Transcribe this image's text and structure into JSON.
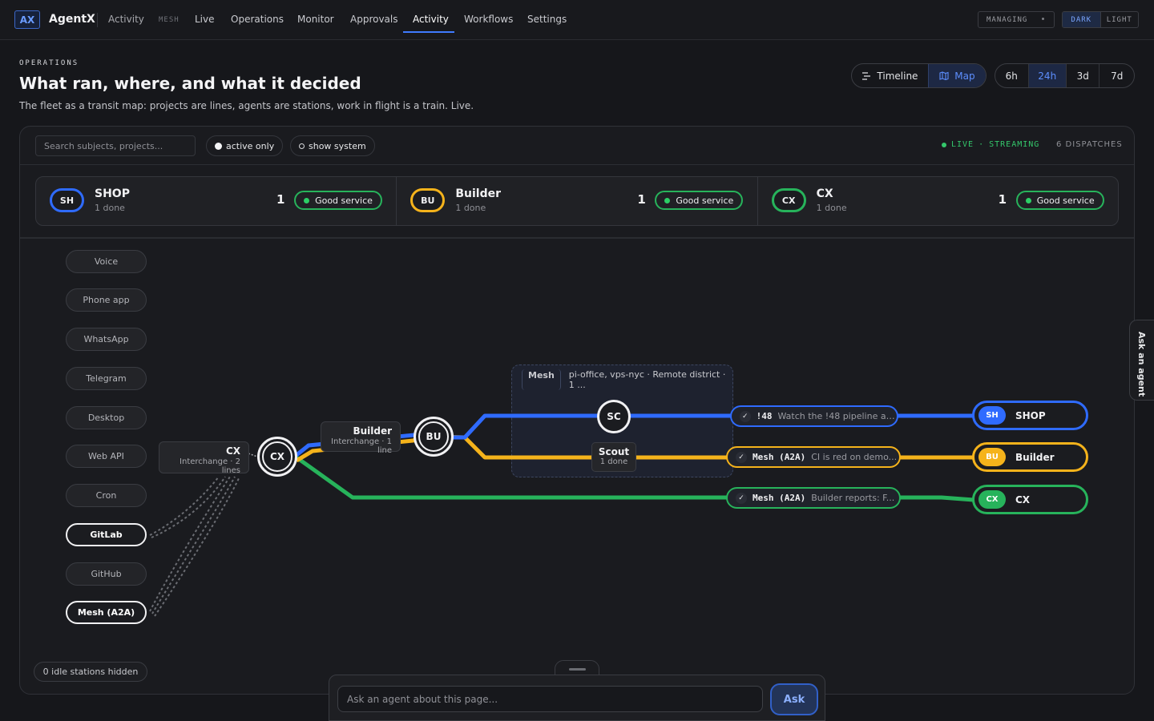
{
  "app": {
    "badge": "AX",
    "name": "AgentX"
  },
  "nav": {
    "activity": "Activity",
    "mesh": "MESH",
    "items": [
      "Live",
      "Operations",
      "Monitor",
      "Approvals",
      "Activity",
      "Workflows",
      "Settings"
    ],
    "active": "Activity",
    "managing": "MANAGING",
    "theme": {
      "dark": "DARK",
      "light": "LIGHT",
      "selected": "DARK"
    }
  },
  "header": {
    "eyebrow": "OPERATIONS",
    "title": "What ran, where, and what it decided",
    "subtitle": "The fleet as a transit map: projects are lines, agents are stations, work in flight is a train. Live.",
    "view_toggle": {
      "timeline": "Timeline",
      "map": "Map",
      "selected": "Map"
    },
    "ranges": [
      "6h",
      "24h",
      "3d",
      "7d"
    ],
    "selected_range": "24h"
  },
  "toolbar": {
    "search_placeholder": "Search subjects, projects...",
    "active_only": "active only",
    "show_system": "show system",
    "live": "LIVE",
    "streaming": "STREAMING",
    "dispatches": "6 DISPATCHES"
  },
  "colors": {
    "shop": "#2f6bff",
    "builder": "#f5b31b",
    "cx": "#27b35b",
    "accent": "#3f7bff",
    "live": "#34c76b"
  },
  "lines": [
    {
      "badge": "SH",
      "name": "SHOP",
      "meta": "1 done",
      "count": "1",
      "status": "Good service"
    },
    {
      "badge": "BU",
      "name": "Builder",
      "meta": "1 done",
      "count": "1",
      "status": "Good service"
    },
    {
      "badge": "CX",
      "name": "CX",
      "meta": "1 done",
      "count": "1",
      "status": "Good service"
    }
  ],
  "sources": [
    {
      "name": "Voice",
      "active": false
    },
    {
      "name": "Phone app",
      "active": false
    },
    {
      "name": "WhatsApp",
      "active": false
    },
    {
      "name": "Telegram",
      "active": false
    },
    {
      "name": "Desktop",
      "active": false
    },
    {
      "name": "Web API",
      "active": false
    },
    {
      "name": "Cron",
      "active": false
    },
    {
      "name": "GitLab",
      "active": true
    },
    {
      "name": "GitHub",
      "active": false
    },
    {
      "name": "Mesh (A2A)",
      "active": true
    }
  ],
  "idle_hidden": "0 idle stations hidden",
  "map": {
    "cx_interchange": {
      "name": "CX",
      "meta": "Interchange · 2 lines"
    },
    "builder_interchange": {
      "name": "Builder",
      "meta": "Interchange · 1 line"
    },
    "hubs": {
      "cx": "CX",
      "bu": "BU"
    },
    "district": {
      "name": "Mesh",
      "meta": "pi-office, vps-nyc · Remote district · 1 ..."
    },
    "sc_station": "SC",
    "scout": {
      "name": "Scout",
      "meta": "1 done"
    },
    "trains": [
      {
        "label": "!48",
        "text": "Watch the !48 pipeline an...",
        "line": "shop"
      },
      {
        "label": "Mesh (A2A)",
        "text": "CI is red on demo...",
        "line": "builder"
      },
      {
        "label": "Mesh (A2A)",
        "text": "Builder reports: F...",
        "line": "cx"
      }
    ],
    "terminals": [
      {
        "badge": "SH",
        "name": "SHOP",
        "line": "shop"
      },
      {
        "badge": "BU",
        "name": "Builder",
        "line": "builder"
      },
      {
        "badge": "CX",
        "name": "CX",
        "line": "cx"
      }
    ]
  },
  "side_tab": "Ask an agent",
  "composer": {
    "placeholder": "Ask an agent about this page...",
    "button": "Ask"
  }
}
